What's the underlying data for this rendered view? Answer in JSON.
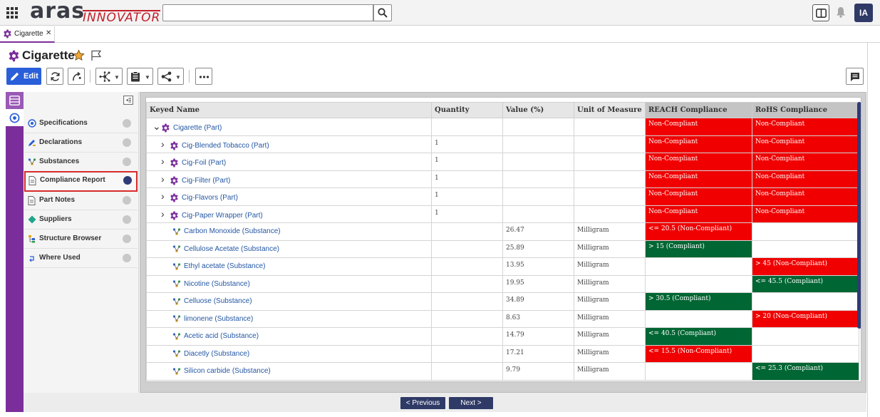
{
  "header": {
    "logo_main": "aras",
    "logo_sub": "INNOVATOR",
    "search_placeholder": "",
    "avatar_initials": "IA"
  },
  "tab": {
    "label": "Cigarette",
    "close": "✕"
  },
  "item": {
    "title": "Cigarette"
  },
  "toolbar": {
    "edit_label": "Edit"
  },
  "sidebar": {
    "items": [
      {
        "label": "Specifications",
        "icon": "specifications-icon"
      },
      {
        "label": "Declarations",
        "icon": "declarations-icon"
      },
      {
        "label": "Substances",
        "icon": "substances-icon"
      },
      {
        "label": "Compliance Report",
        "icon": "document-icon",
        "selected": true
      },
      {
        "label": "Part Notes",
        "icon": "document-icon"
      },
      {
        "label": "Suppliers",
        "icon": "diamond-icon"
      },
      {
        "label": "Structure Browser",
        "icon": "structure-icon"
      },
      {
        "label": "Where Used",
        "icon": "where-used-icon"
      }
    ]
  },
  "grid": {
    "columns": [
      "Keyed Name",
      "Quantity",
      "Value (%)",
      "Unit of Measure",
      "REACH Compliance",
      "RoHS Compliance"
    ],
    "rows": [
      {
        "name": "Cigarette (Part)",
        "type": "part",
        "level": 0,
        "expander": "v",
        "qty": "",
        "value": "",
        "uom": "",
        "reach": "Non-Compliant",
        "reach_status": "red",
        "rohs": "Non-Compliant",
        "rohs_status": "red"
      },
      {
        "name": "Cig-Blended Tobacco (Part)",
        "type": "part",
        "level": 1,
        "expander": ">",
        "qty": "1",
        "value": "",
        "uom": "",
        "reach": "Non-Compliant",
        "reach_status": "red",
        "rohs": "Non-Compliant",
        "rohs_status": "red"
      },
      {
        "name": "Cig-Foil (Part)",
        "type": "part",
        "level": 1,
        "expander": ">",
        "qty": "1",
        "value": "",
        "uom": "",
        "reach": "Non-Compliant",
        "reach_status": "red",
        "rohs": "Non-Compliant",
        "rohs_status": "red"
      },
      {
        "name": "Cig-Filter (Part)",
        "type": "part",
        "level": 1,
        "expander": ">",
        "qty": "1",
        "value": "",
        "uom": "",
        "reach": "Non-Compliant",
        "reach_status": "red",
        "rohs": "Non-Compliant",
        "rohs_status": "red"
      },
      {
        "name": "Cig-Flavors (Part)",
        "type": "part",
        "level": 1,
        "expander": ">",
        "qty": "1",
        "value": "",
        "uom": "",
        "reach": "Non-Compliant",
        "reach_status": "red",
        "rohs": "Non-Compliant",
        "rohs_status": "red"
      },
      {
        "name": "Cig-Paper Wrapper (Part)",
        "type": "part",
        "level": 1,
        "expander": ">",
        "qty": "1",
        "value": "",
        "uom": "",
        "reach": "Non-Compliant",
        "reach_status": "red",
        "rohs": "Non-Compliant",
        "rohs_status": "red"
      },
      {
        "name": "Carbon Monoxide (Substance)",
        "type": "substance",
        "level": 2,
        "expander": "",
        "qty": "",
        "value": "26.47",
        "uom": "Milligram",
        "reach": "<= 20.5 (Non-Compliant)",
        "reach_status": "red",
        "rohs": "",
        "rohs_status": ""
      },
      {
        "name": "Cellulose Acetate (Substance)",
        "type": "substance",
        "level": 2,
        "expander": "",
        "qty": "",
        "value": "25.89",
        "uom": "Milligram",
        "reach": "> 15 (Compliant)",
        "reach_status": "green",
        "rohs": "",
        "rohs_status": ""
      },
      {
        "name": "Ethyl acetate (Substance)",
        "type": "substance",
        "level": 2,
        "expander": "",
        "qty": "",
        "value": "13.95",
        "uom": "Milligram",
        "reach": "",
        "reach_status": "",
        "rohs": "> 45 (Non-Compliant)",
        "rohs_status": "red"
      },
      {
        "name": "Nicotine (Substance)",
        "type": "substance",
        "level": 2,
        "expander": "",
        "qty": "",
        "value": "19.95",
        "uom": "Milligram",
        "reach": "",
        "reach_status": "",
        "rohs": "<= 45.5 (Compliant)",
        "rohs_status": "green"
      },
      {
        "name": "Celluose (Substance)",
        "type": "substance",
        "level": 2,
        "expander": "",
        "qty": "",
        "value": "34.89",
        "uom": "Milligram",
        "reach": "> 30.5 (Compliant)",
        "reach_status": "green",
        "rohs": "",
        "rohs_status": ""
      },
      {
        "name": "limonene (Substance)",
        "type": "substance",
        "level": 2,
        "expander": "",
        "qty": "",
        "value": "8.63",
        "uom": "Milligram",
        "reach": "",
        "reach_status": "",
        "rohs": "> 20 (Non-Compliant)",
        "rohs_status": "red"
      },
      {
        "name": "Acetic acid (Substance)",
        "type": "substance",
        "level": 2,
        "expander": "",
        "qty": "",
        "value": "14.79",
        "uom": "Milligram",
        "reach": "<= 40.5 (Compliant)",
        "reach_status": "green",
        "rohs": "",
        "rohs_status": ""
      },
      {
        "name": "Diacetly (Substance)",
        "type": "substance",
        "level": 2,
        "expander": "",
        "qty": "",
        "value": "17.21",
        "uom": "Milligram",
        "reach": "<= 15.5 (Non-Compliant)",
        "reach_status": "red",
        "rohs": "",
        "rohs_status": ""
      },
      {
        "name": "Silicon carbide (Substance)",
        "type": "substance",
        "level": 2,
        "expander": "",
        "qty": "",
        "value": "9.79",
        "uom": "Milligram",
        "reach": "",
        "reach_status": "",
        "rohs": "<= 25.3 (Compliant)",
        "rohs_status": "green"
      }
    ]
  },
  "pager": {
    "previous": "< Previous",
    "next": "Next >"
  },
  "colors": {
    "accent": "#7b2e9b",
    "primary": "#2a5fd9",
    "navy": "#2f3a66",
    "noncompliant": "#f00000",
    "compliant": "#006633"
  }
}
